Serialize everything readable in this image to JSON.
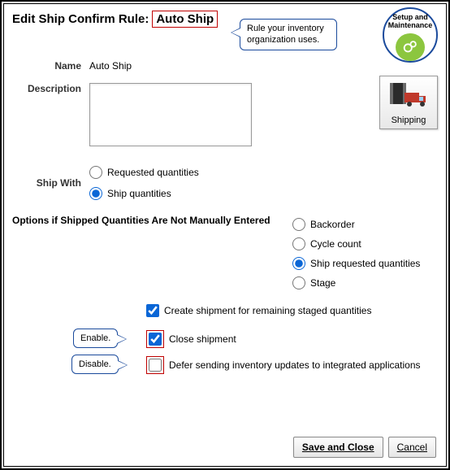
{
  "title": {
    "prefix": "Edit Ship Confirm Rule:",
    "value": "Auto Ship"
  },
  "callouts": {
    "top": "Rule your inventory organization uses.",
    "enable": "Enable.",
    "disable": "Disable."
  },
  "badges": {
    "setup": "Setup and Maintenance",
    "shipping": "Shipping"
  },
  "fields": {
    "name_label": "Name",
    "name_value": "Auto Ship",
    "description_label": "Description",
    "description_value": ""
  },
  "shipWith": {
    "label": "Ship With",
    "options": {
      "requested": "Requested quantities",
      "ship": "Ship quantities"
    },
    "selected": "ship"
  },
  "optionsHeading": "Options if Shipped Quantities Are Not Manually Entered",
  "options": {
    "backorder": "Backorder",
    "cycle": "Cycle count",
    "shipReq": "Ship requested quantities",
    "stage": "Stage",
    "selected": "shipReq"
  },
  "checks": {
    "createRemaining": {
      "label": "Create shipment for remaining staged quantities",
      "checked": true
    },
    "closeShipment": {
      "label": "Close shipment",
      "checked": true
    },
    "deferUpdates": {
      "label": "Defer sending inventory updates to integrated applications",
      "checked": false
    }
  },
  "buttons": {
    "save": "Save and Close",
    "cancel": "Cancel"
  }
}
